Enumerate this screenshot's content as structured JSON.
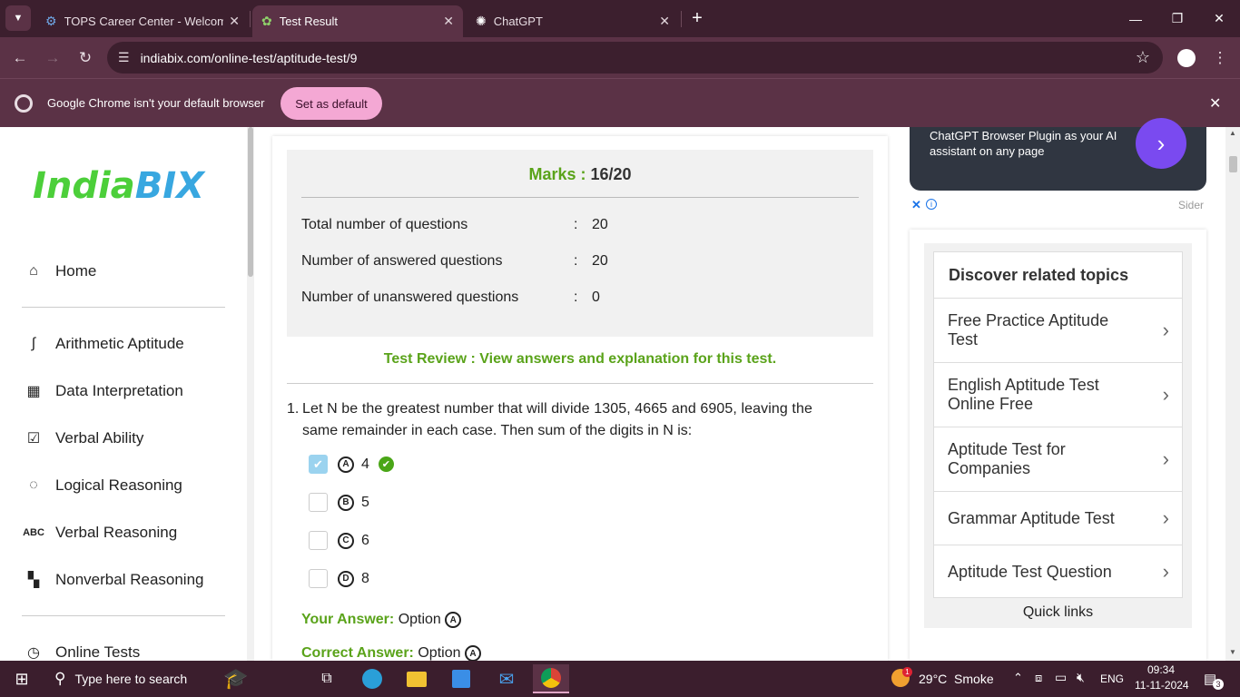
{
  "tabs": [
    {
      "title": "TOPS Career Center - Welcome",
      "close": "✕"
    },
    {
      "title": "Test Result",
      "close": "✕"
    },
    {
      "title": "ChatGPT",
      "close": "✕"
    }
  ],
  "new_tab": "+",
  "address": "indiabix.com/online-test/aptitude-test/9",
  "infobar": {
    "message": "Google Chrome isn't your default browser",
    "button": "Set as default"
  },
  "logo": {
    "part1": "India",
    "part2": "BIX"
  },
  "sidebar": {
    "items": [
      {
        "label": "Home",
        "icon": "home-icon"
      },
      {
        "label": "Arithmetic Aptitude",
        "icon": "function-icon"
      },
      {
        "label": "Data Interpretation",
        "icon": "bar-chart-icon"
      },
      {
        "label": "Verbal Ability",
        "icon": "checklist-icon"
      },
      {
        "label": "Logical Reasoning",
        "icon": "cycle-icon"
      },
      {
        "label": "Verbal Reasoning",
        "icon": "abc-icon"
      },
      {
        "label": "Nonverbal Reasoning",
        "icon": "dashboard-icon"
      },
      {
        "label": "Online Tests",
        "icon": "clock-icon"
      }
    ]
  },
  "summary": {
    "marks_label": "Marks :",
    "marks_value": "16/20",
    "rows": [
      {
        "label": "Total number of questions",
        "colon": ":",
        "value": "20"
      },
      {
        "label": "Number of answered questions",
        "colon": ":",
        "value": "20"
      },
      {
        "label": "Number of unanswered questions",
        "colon": ":",
        "value": "0"
      }
    ]
  },
  "review_link": "Test Review : View answers and explanation for this test.",
  "question": {
    "number": "1.",
    "text_line1": "Let N be the greatest number that will divide 1305, 4665 and 6905, leaving the",
    "text_line2": "same remainder in each case. Then sum of the digits in N is:",
    "options": [
      {
        "letter": "A",
        "value": "4",
        "checked": true,
        "correct": true
      },
      {
        "letter": "B",
        "value": "5",
        "checked": false
      },
      {
        "letter": "C",
        "value": "6",
        "checked": false
      },
      {
        "letter": "D",
        "value": "8",
        "checked": false
      }
    ],
    "your_answer_label": "Your Answer:",
    "your_answer_value": "Option",
    "your_answer_letter": "A",
    "correct_answer_label": "Correct Answer:",
    "correct_answer_value": "Option",
    "correct_answer_letter": "A"
  },
  "ad": {
    "text_line1": "ChatGPT Browser Plugin as your AI",
    "text_line2": "assistant on any page",
    "brand": "Sider"
  },
  "topics": {
    "heading": "Discover related topics",
    "items": [
      {
        "line1": "Free Practice Aptitude",
        "line2": "Test"
      },
      {
        "line1": "English Aptitude Test",
        "line2": "Online Free"
      },
      {
        "line1": "Aptitude Test for",
        "line2": "Companies"
      },
      {
        "line1": "Grammar Aptitude Test",
        "line2": ""
      },
      {
        "line1": "Aptitude Test Question",
        "line2": ""
      }
    ],
    "footer": "Quick links"
  },
  "taskbar": {
    "search": "Type here to search",
    "weather": "29°C  Smoke",
    "lang": "ENG",
    "time": "09:34",
    "date": "11-11-2024",
    "weather_badge": "1",
    "notifications": "3"
  }
}
